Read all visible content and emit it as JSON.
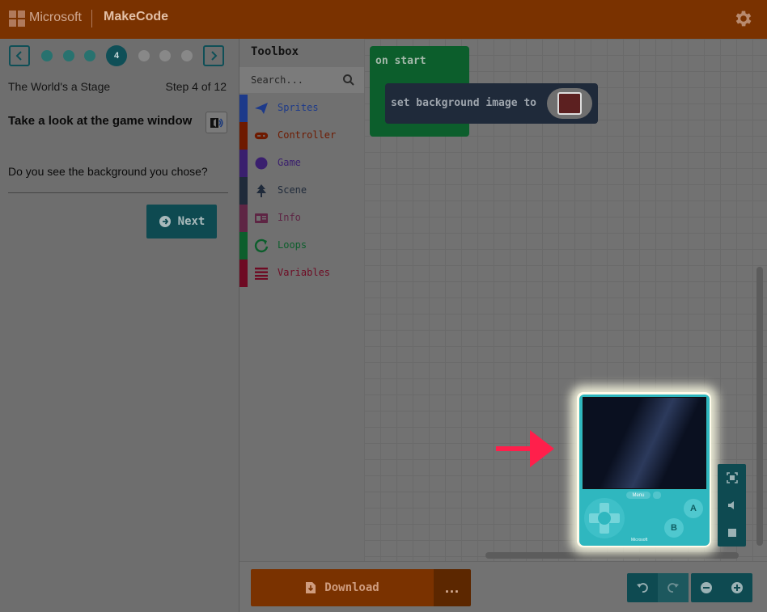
{
  "header": {
    "brand": "Microsoft",
    "product": "MakeCode",
    "settings_icon": "gear-icon"
  },
  "tutorial": {
    "current_step_marker": "4",
    "name": "The World's a Stage",
    "step_label": "Step 4 of 12",
    "heading": "Take a look at the game window",
    "body": "Do you see the background you chose?",
    "next_label": "Next",
    "prev_icon": "chevron-left-icon",
    "next_step_icon": "chevron-right-icon"
  },
  "toolbox": {
    "title": "Toolbox",
    "search_placeholder": "Search...",
    "categories": [
      {
        "label": "Sprites",
        "color": "#1d3a8a",
        "icon": "paper-plane-icon"
      },
      {
        "label": "Controller",
        "color": "#6e1a00",
        "icon": "gamepad-icon"
      },
      {
        "label": "Game",
        "color": "#3a1f6e",
        "icon": "circle-icon"
      },
      {
        "label": "Scene",
        "color": "#1f2a3a",
        "icon": "tree-icon"
      },
      {
        "label": "Info",
        "color": "#5e2544",
        "icon": "id-card-icon"
      },
      {
        "label": "Loops",
        "color": "#0c5e2c",
        "icon": "loop-arrow-icon"
      },
      {
        "label": "Variables",
        "color": "#6e0a23",
        "icon": "list-icon"
      }
    ]
  },
  "blocks": {
    "on_start": "on start",
    "set_background": "set background image to"
  },
  "simulator": {
    "menu_label": "Menu",
    "a_label": "A",
    "b_label": "B",
    "brand_label": "Microsoft"
  },
  "bottombar": {
    "download_label": "Download",
    "more_label": "..."
  },
  "colors": {
    "header": "#7a3200",
    "accent_teal": "#0e4a51",
    "arrow": "#ff1f4b"
  }
}
